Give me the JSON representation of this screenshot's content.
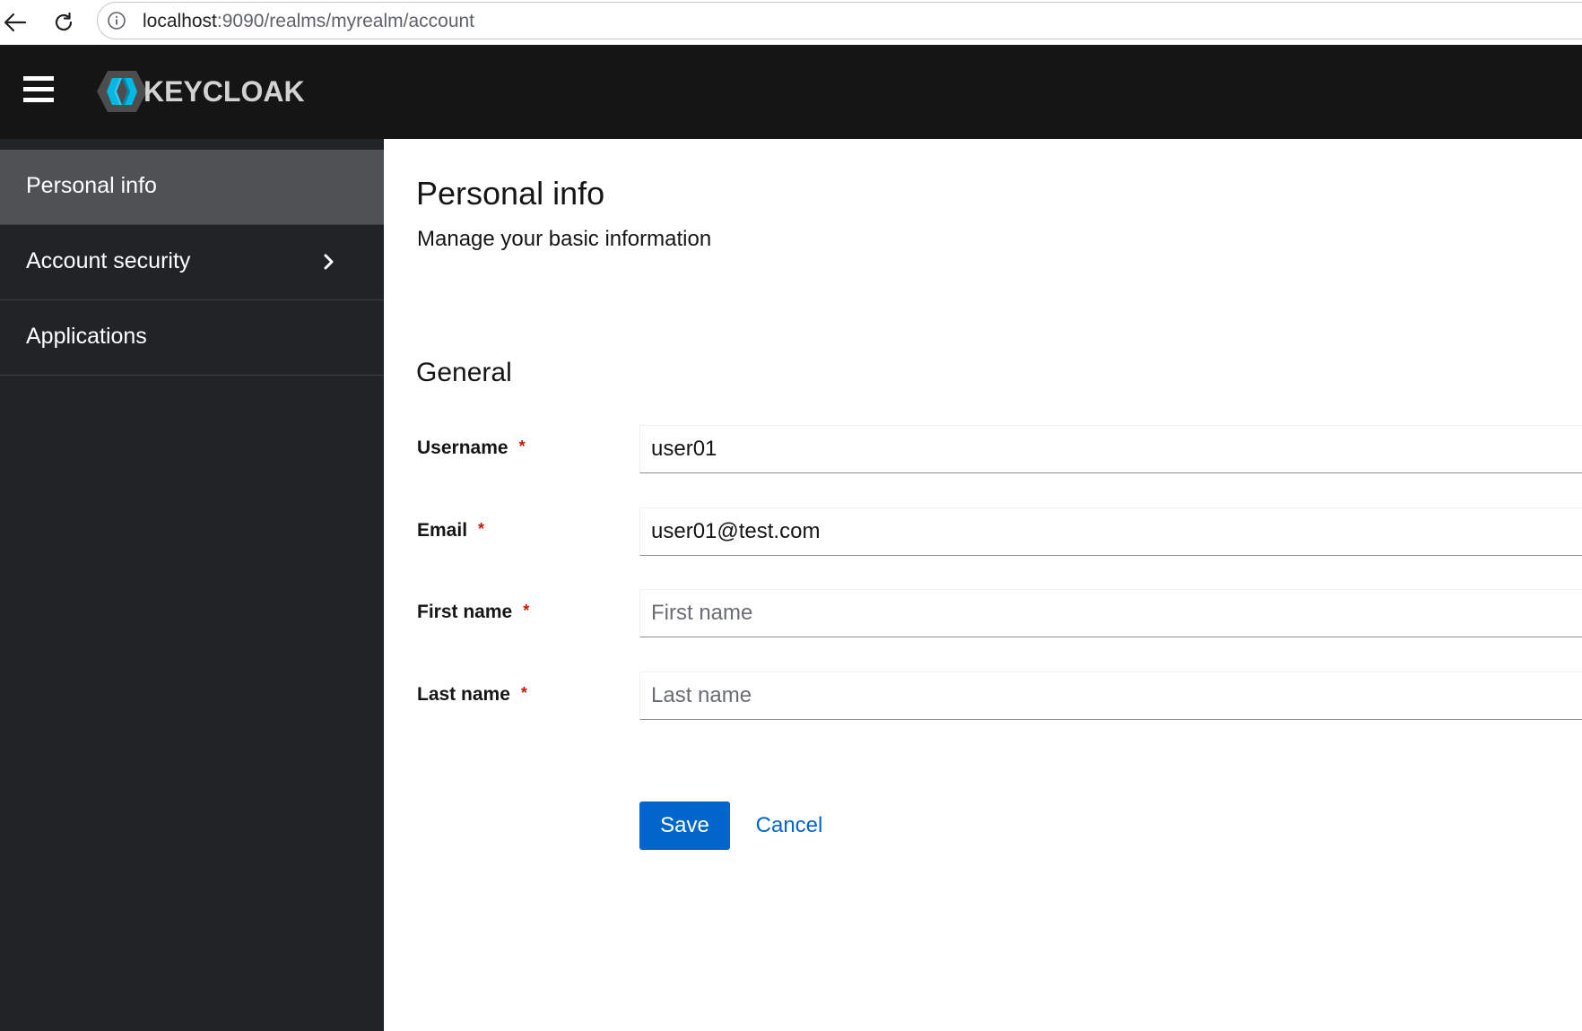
{
  "browser": {
    "url_host": "localhost",
    "url_rest": ":9090/realms/myrealm/account"
  },
  "masthead": {
    "logo_text": "KEYCLOAK"
  },
  "sidebar": {
    "items": [
      {
        "label": "Personal info",
        "active": true
      },
      {
        "label": "Account security",
        "active": false,
        "has_chevron": true
      },
      {
        "label": "Applications",
        "active": false
      }
    ]
  },
  "page": {
    "title": "Personal info",
    "subtitle": "Manage your basic information",
    "section_title": "General"
  },
  "form": {
    "fields": [
      {
        "label": "Username",
        "required_mark": "*",
        "value": "user01",
        "placeholder": ""
      },
      {
        "label": "Email",
        "required_mark": "*",
        "value": "user01@test.com",
        "placeholder": ""
      },
      {
        "label": "First name",
        "required_mark": "*",
        "value": "",
        "placeholder": "First name"
      },
      {
        "label": "Last name",
        "required_mark": "*",
        "value": "",
        "placeholder": "Last name"
      }
    ],
    "save_label": "Save",
    "cancel_label": "Cancel"
  },
  "colors": {
    "masthead_bg": "#151515",
    "sidebar_bg": "#212427",
    "sidebar_active_bg": "#4f5255",
    "primary": "#0066cc",
    "required": "#c9190b"
  },
  "icons": [
    "back-arrow-icon",
    "reload-icon",
    "site-info-icon",
    "hamburger-menu-icon",
    "keycloak-logo-icon",
    "chevron-right-icon"
  ]
}
